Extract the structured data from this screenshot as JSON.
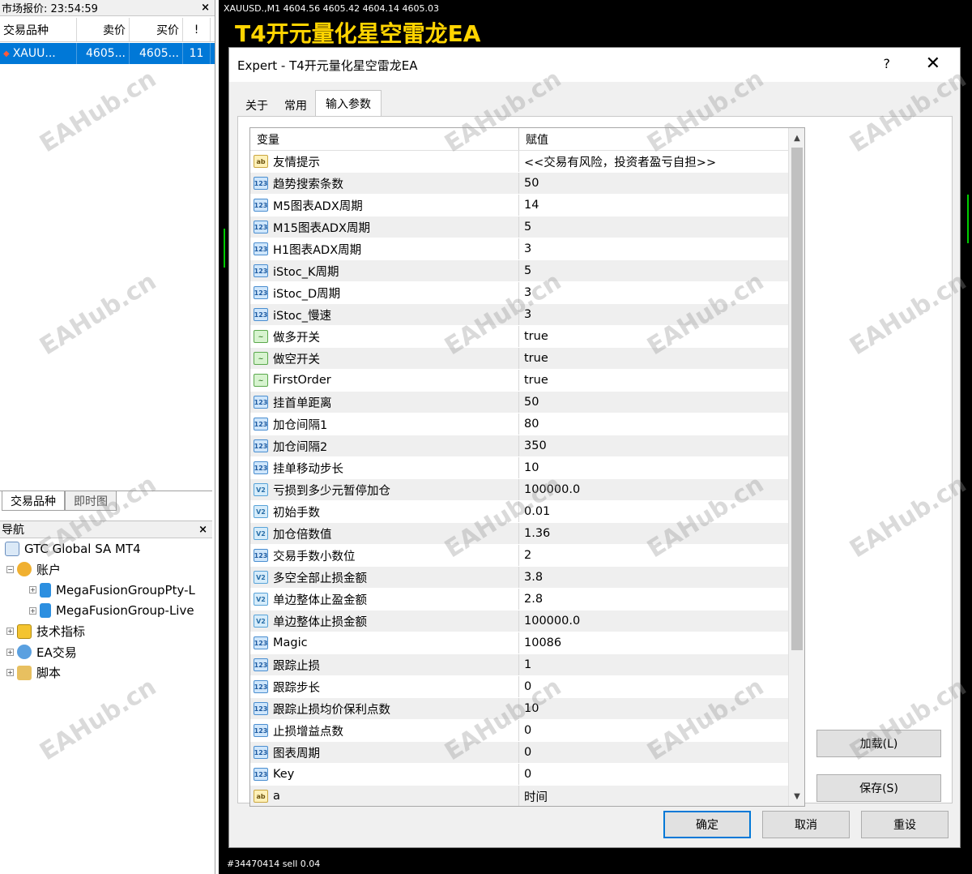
{
  "market_watch": {
    "title": "市场报价: 23:54:59",
    "columns": [
      "交易品种",
      "卖价",
      "买价",
      "!"
    ],
    "rows": [
      {
        "symbol": "XAUU...",
        "bid": "4605...",
        "ask": "4605...",
        "spread": "11"
      }
    ],
    "tabs": [
      "交易品种",
      "即时图"
    ]
  },
  "navigator": {
    "title": "导航",
    "items": [
      {
        "label": "GTC Global SA MT4"
      },
      {
        "label": "账户"
      },
      {
        "label": "MegaFusionGroupPty-L"
      },
      {
        "label": "MegaFusionGroup-Live"
      },
      {
        "label": "技术指标"
      },
      {
        "label": "EA交易"
      },
      {
        "label": "脚本"
      }
    ]
  },
  "chart": {
    "info": "XAUUSD.,M1  4604.56 4605.42 4604.14 4605.03",
    "ea_title": "T4开元量化星空雷龙EA",
    "bottom_text": "#34470414 sell 0.04"
  },
  "dialog": {
    "title": "Expert - T4开元量化星空雷龙EA",
    "help": "?",
    "tabs": [
      "关于",
      "常用",
      "输入参数"
    ],
    "active_tab": "输入参数",
    "col_variable": "变量",
    "col_value": "赋值",
    "params": [
      {
        "type": "str",
        "name": "友情提示",
        "value": "<<交易有风险，投资者盈亏自担>>"
      },
      {
        "type": "int",
        "name": "趋势搜索条数",
        "value": "50"
      },
      {
        "type": "int",
        "name": "M5图表ADX周期",
        "value": "14"
      },
      {
        "type": "int",
        "name": "M15图表ADX周期",
        "value": "5"
      },
      {
        "type": "int",
        "name": "H1图表ADX周期",
        "value": "3"
      },
      {
        "type": "int",
        "name": "iStoc_K周期",
        "value": "5"
      },
      {
        "type": "int",
        "name": "iStoc_D周期",
        "value": "3"
      },
      {
        "type": "int",
        "name": "iStoc_慢速",
        "value": "3"
      },
      {
        "type": "bool",
        "name": "做多开关",
        "value": "true"
      },
      {
        "type": "bool",
        "name": "做空开关",
        "value": "true"
      },
      {
        "type": "bool",
        "name": "FirstOrder",
        "value": "true"
      },
      {
        "type": "int",
        "name": "挂首单距离",
        "value": "50"
      },
      {
        "type": "int",
        "name": "加仓间隔1",
        "value": "80"
      },
      {
        "type": "int",
        "name": "加仓间隔2",
        "value": "350"
      },
      {
        "type": "int",
        "name": "挂单移动步长",
        "value": "10"
      },
      {
        "type": "dbl",
        "name": "亏损到多少元暂停加仓",
        "value": "100000.0"
      },
      {
        "type": "dbl",
        "name": "初始手数",
        "value": "0.01"
      },
      {
        "type": "dbl",
        "name": "加仓倍数值",
        "value": "1.36"
      },
      {
        "type": "int",
        "name": "交易手数小数位",
        "value": "2"
      },
      {
        "type": "dbl",
        "name": "多空全部止损金额",
        "value": "3.8"
      },
      {
        "type": "dbl",
        "name": "单边整体止盈金额",
        "value": "2.8"
      },
      {
        "type": "dbl",
        "name": "单边整体止损金额",
        "value": "100000.0"
      },
      {
        "type": "int",
        "name": "Magic",
        "value": "10086"
      },
      {
        "type": "int",
        "name": "跟踪止损",
        "value": "1"
      },
      {
        "type": "int",
        "name": "跟踪步长",
        "value": "0"
      },
      {
        "type": "int",
        "name": "跟踪止损均价保利点数",
        "value": "10"
      },
      {
        "type": "int",
        "name": "止损增益点数",
        "value": "0"
      },
      {
        "type": "int",
        "name": "图表周期",
        "value": "0"
      },
      {
        "type": "int",
        "name": "Key",
        "value": "0"
      },
      {
        "type": "str",
        "name": "a",
        "value": "时间"
      }
    ],
    "icon_text": {
      "int": "123",
      "str": "ab",
      "dbl": "V2",
      "bool": "~"
    },
    "load_button": "加载(L)",
    "save_button": "保存(S)",
    "ok_button": "确定",
    "cancel_button": "取消",
    "reset_button": "重设"
  },
  "watermark": "EAHub.cn"
}
